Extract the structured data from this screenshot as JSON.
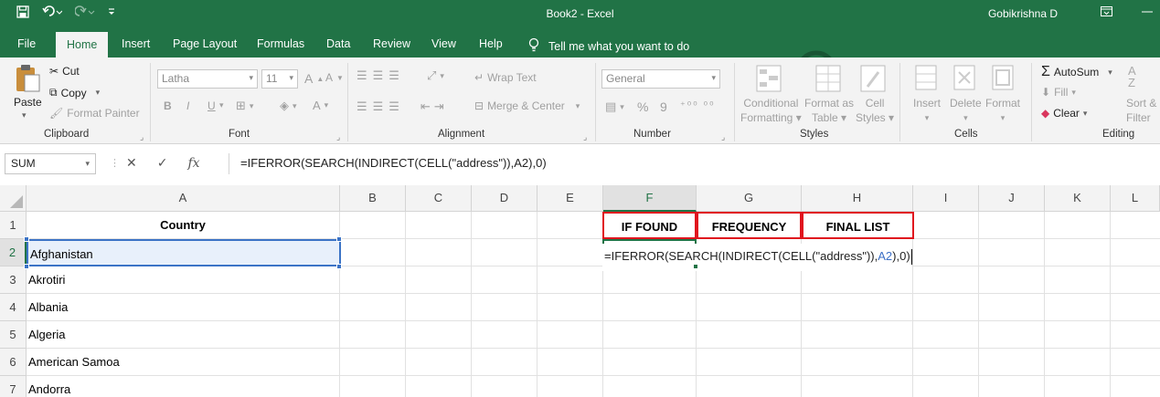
{
  "window": {
    "title": "Book2  -  Excel",
    "user": "Gobikrishna D"
  },
  "tabs": [
    "File",
    "Home",
    "Insert",
    "Page Layout",
    "Formulas",
    "Data",
    "Review",
    "View",
    "Help"
  ],
  "active_tab": "Home",
  "tell_me": "Tell me what you want to do",
  "ribbon": {
    "clipboard": {
      "paste": "Paste",
      "cut": "Cut",
      "copy": "Copy",
      "format_painter": "Format Painter",
      "label": "Clipboard"
    },
    "font": {
      "name": "Latha",
      "size": "11",
      "label": "Font",
      "increase": "A",
      "decrease": "A",
      "bold": "B",
      "italic": "I",
      "underline": "U"
    },
    "alignment": {
      "wrap_text": "Wrap Text",
      "merge_center": "Merge & Center",
      "label": "Alignment"
    },
    "number": {
      "format": "General",
      "percent": "%",
      "comma": "9",
      "label": "Number"
    },
    "styles": {
      "conditional": "Conditional",
      "conditional2": "Formatting",
      "format_as": "Format as",
      "format_as2": "Table",
      "cell": "Cell",
      "cell2": "Styles",
      "label": "Styles"
    },
    "cells": {
      "insert": "Insert",
      "delete": "Delete",
      "format": "Format",
      "label": "Cells"
    },
    "editing": {
      "autosum": "AutoSum",
      "fill": "Fill",
      "clear": "Clear",
      "sort": "Sort &",
      "filter": "Filter",
      "label": "Editing"
    }
  },
  "formula_bar": {
    "name_box": "SUM",
    "cancel": "✕",
    "enter": "✓",
    "fx": "fx",
    "formula": "=IFERROR(SEARCH(INDIRECT(CELL(\"address\")),A2),0)"
  },
  "columns": [
    "A",
    "B",
    "C",
    "D",
    "E",
    "F",
    "G",
    "H",
    "I",
    "J",
    "K",
    "L"
  ],
  "rows": [
    "1",
    "2",
    "3",
    "4",
    "5",
    "6",
    "7"
  ],
  "cells": {
    "A1": "Country",
    "F1": "IF  FOUND",
    "G1": "FREQUENCY",
    "H1": "FINAL  LIST",
    "A2": "Afghanistan",
    "A3": "Akrotiri",
    "A4": "Albania",
    "A5": "Algeria",
    "A6": "American  Samoa",
    "A7": "Andorra"
  },
  "editor": {
    "p1": "=IFERROR(SEARCH(INDIRECT(CELL(\"address\")),",
    "p2": "A2",
    "p3": "),0)"
  },
  "colors": {
    "excel_green": "#217346",
    "ref_blue": "#3b6fc6",
    "header_red": "#e0141e"
  }
}
